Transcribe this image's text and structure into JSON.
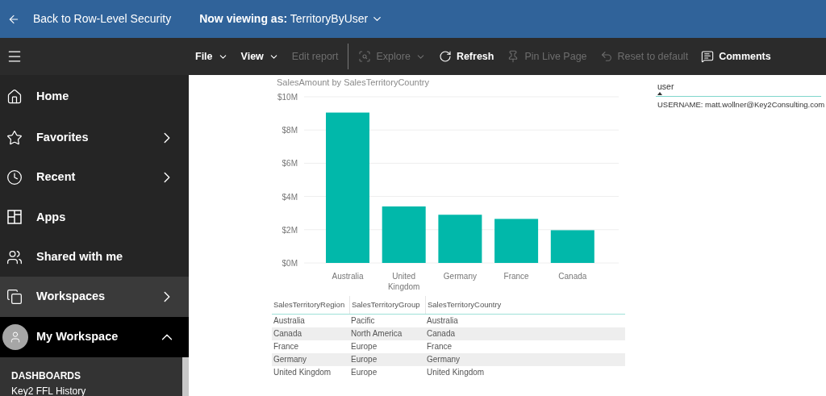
{
  "header": {
    "back_label": "Back to Row-Level Security",
    "viewing_prefix": "Now viewing as:",
    "viewing_role": "TerritoryByUser"
  },
  "toolbar": [
    {
      "label": "File",
      "kind": "menu",
      "disabled": false
    },
    {
      "label": "View",
      "kind": "menu",
      "disabled": false
    },
    {
      "label": "Edit report",
      "kind": "plain",
      "disabled": true
    },
    {
      "label": "Explore",
      "kind": "explore",
      "disabled": true
    },
    {
      "label": "Refresh",
      "kind": "refresh",
      "disabled": false
    },
    {
      "label": "Pin Live Page",
      "kind": "pin",
      "disabled": true
    },
    {
      "label": "Reset to default",
      "kind": "reset",
      "disabled": true
    },
    {
      "label": "Comments",
      "kind": "comments",
      "disabled": false
    }
  ],
  "sidebar": {
    "items": [
      {
        "label": "Home",
        "kind": "home",
        "chevron": false,
        "selected": false
      },
      {
        "label": "Favorites",
        "kind": "star",
        "chevron": true,
        "selected": false
      },
      {
        "label": "Recent",
        "kind": "clock",
        "chevron": true,
        "selected": false
      },
      {
        "label": "Apps",
        "kind": "apps",
        "chevron": false,
        "selected": false
      },
      {
        "label": "Shared with me",
        "kind": "shared",
        "chevron": false,
        "selected": false
      },
      {
        "label": "Workspaces",
        "kind": "workspaces",
        "chevron": true,
        "selected": true
      }
    ],
    "my_workspace": {
      "label": "My Workspace",
      "expanded": true,
      "section": "DASHBOARDS",
      "items": [
        "Key2 FFL History"
      ]
    }
  },
  "chart": {
    "chart_data": {
      "type": "bar",
      "title": "SalesAmount by SalesTerritoryCountry",
      "categories": [
        "Australia",
        "United Kingdom",
        "Germany",
        "France",
        "Canada"
      ],
      "grid": true,
      "series": [
        {
          "color": "#01b8aa",
          "values": [
            9050000,
            3400000,
            2900000,
            2650000,
            1970000
          ]
        }
      ],
      "ylim": [
        0,
        10000000
      ],
      "yticks": [
        {
          "value": 0,
          "label": "$0M"
        },
        {
          "value": 2000000,
          "label": "$2M"
        },
        {
          "value": 4000000,
          "label": "$4M"
        },
        {
          "value": 6000000,
          "label": "$6M"
        },
        {
          "value": 8000000,
          "label": "$8M"
        },
        {
          "value": 10000000,
          "label": "$10M"
        }
      ]
    }
  },
  "table": {
    "columns": [
      "SalesTerritoryRegion",
      "SalesTerritoryGroup",
      "SalesTerritoryCountry"
    ],
    "rows": [
      [
        "Australia",
        "Pacific",
        "Australia"
      ],
      [
        "Canada",
        "North America",
        "Canada"
      ],
      [
        "France",
        "Europe",
        "France"
      ],
      [
        "Germany",
        "Europe",
        "Germany"
      ],
      [
        "United Kingdom",
        "Europe",
        "United Kingdom"
      ]
    ]
  },
  "user_card": {
    "title": "user",
    "value": "USERNAME: matt.wollner@Key2Consulting.com"
  }
}
